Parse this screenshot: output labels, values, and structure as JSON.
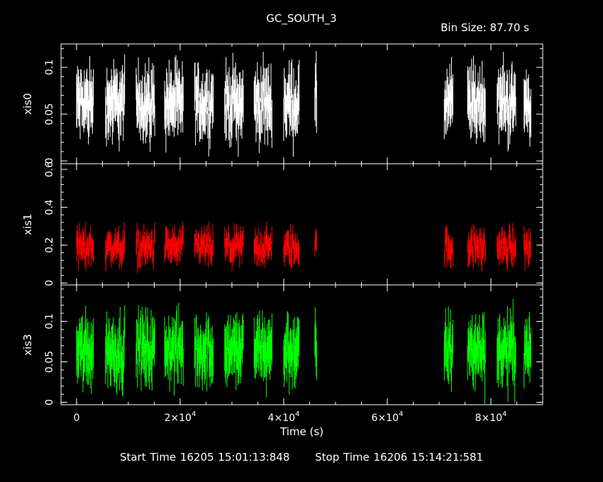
{
  "title": "GC_SOUTH_3",
  "bin_size": "Bin Size: 87.70 s",
  "footer": {
    "start": "Start Time 16205 15:01:13:848",
    "stop": "Stop Time 16206 15:14:21:581"
  },
  "chart_data": {
    "type": "scatter",
    "xlabel": "Time (s)",
    "xlim": [
      -3000,
      90000
    ],
    "x_ticks": [
      0,
      20000,
      40000,
      60000,
      80000
    ],
    "x_tick_labels": [
      {
        "mantissa": "0",
        "exp": ""
      },
      {
        "mantissa": "2×10",
        "exp": "4"
      },
      {
        "mantissa": "4×10",
        "exp": "4"
      },
      {
        "mantissa": "6×10",
        "exp": "4"
      },
      {
        "mantissa": "8×10",
        "exp": "4"
      }
    ],
    "segments": [
      [
        0,
        3300
      ],
      [
        5600,
        9300
      ],
      [
        11500,
        15100
      ],
      [
        17000,
        20600
      ],
      [
        22800,
        26400
      ],
      [
        28600,
        32200
      ],
      [
        34300,
        37800
      ],
      [
        40000,
        43000
      ],
      [
        46000,
        46400
      ],
      [
        71000,
        72700
      ],
      [
        75500,
        79000
      ],
      [
        81200,
        84800
      ],
      [
        86400,
        87800
      ]
    ],
    "panels": [
      {
        "ylabel": "xis0",
        "color": "#ffffff",
        "ylim": [
          -0.003,
          0.125
        ],
        "y_ticks": [
          0,
          0.05,
          0.1
        ],
        "y_tick_labels": [
          "0",
          "0.05",
          "0.1"
        ],
        "mean": 0.062,
        "scatter": 0.016,
        "errbar": 0.022
      },
      {
        "ylabel": "xis1",
        "color": "#ff0000",
        "ylim": [
          -0.01,
          0.63
        ],
        "y_ticks": [
          0,
          0.2,
          0.4,
          0.6
        ],
        "y_tick_labels": [
          "0",
          "0.2",
          "0.4",
          "0.6"
        ],
        "mean": 0.19,
        "scatter": 0.045,
        "errbar": 0.05
      },
      {
        "ylabel": "xis3",
        "color": "#00ff00",
        "ylim": [
          -0.003,
          0.145
        ],
        "y_ticks": [
          0,
          0.05,
          0.1
        ],
        "y_tick_labels": [
          "0",
          "0.05",
          "0.1"
        ],
        "mean": 0.065,
        "scatter": 0.018,
        "errbar": 0.024
      }
    ]
  }
}
